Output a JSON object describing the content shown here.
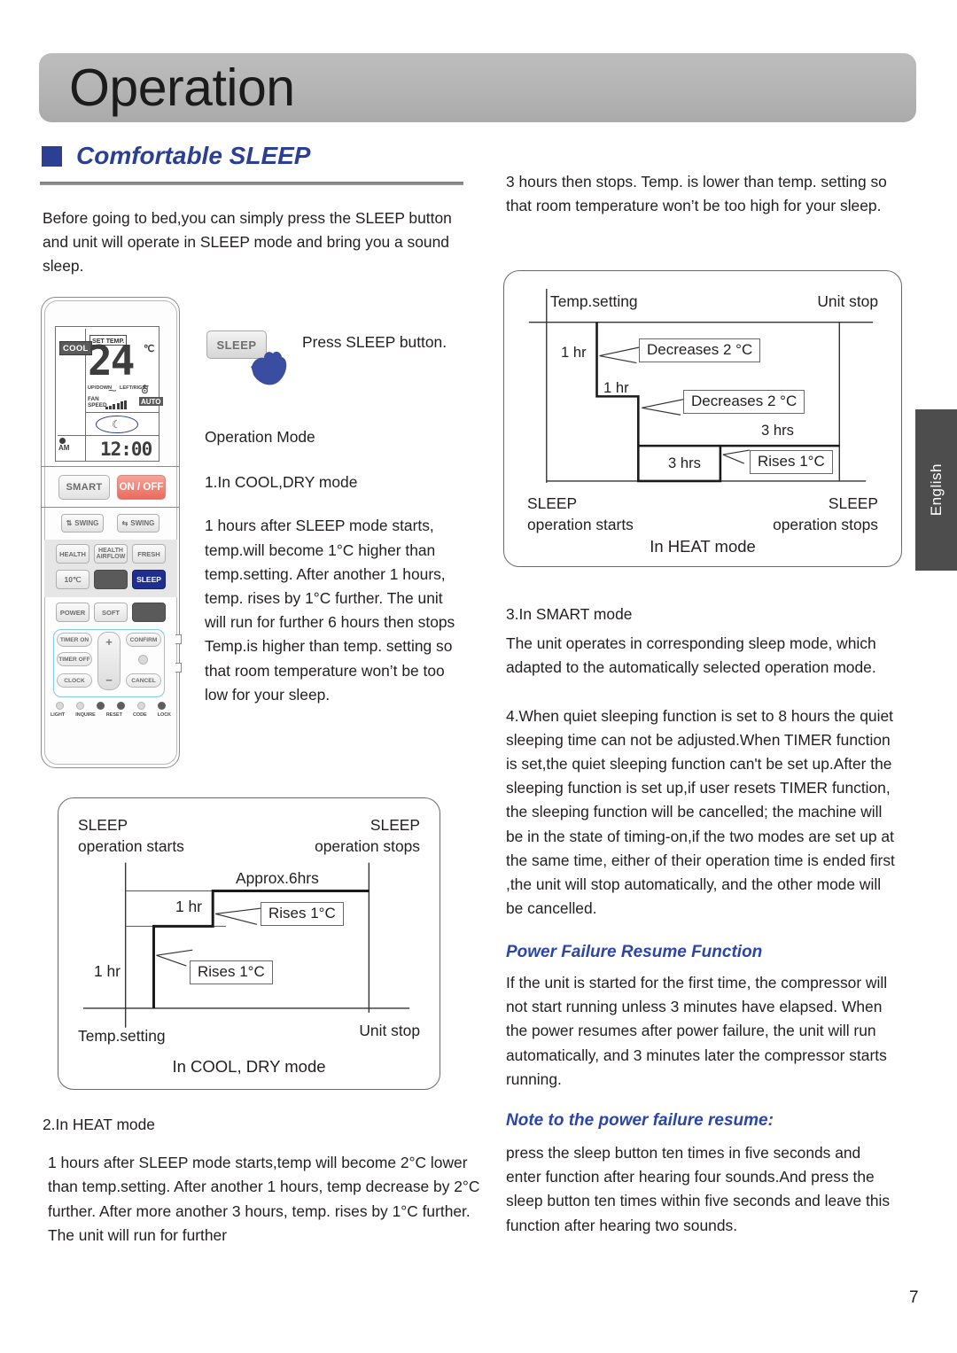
{
  "header": {
    "title": "Operation"
  },
  "section": {
    "title": "Comfortable SLEEP"
  },
  "page_number": "7",
  "language_tab": "English",
  "left_column": {
    "intro": "Before going to bed,you can simply press the SLEEP button and unit will operate in SLEEP mode and bring you a sound sleep.",
    "press_instruction": "Press SLEEP button.",
    "sleep_button_label": "SLEEP",
    "operation_mode_heading": "Operation Mode",
    "mode1_heading": "1.In COOL,DRY mode",
    "mode1_body": "1 hours after SLEEP mode starts, temp.will become 1°C higher than temp.setting. After another 1 hours, temp. rises by 1°C further. The unit will run for further 6 hours then stops Temp.is higher than temp. setting so that room temperature won’t be too low for your sleep.",
    "mode2_heading": "2.In HEAT mode",
    "mode2_body": "1 hours after SLEEP mode starts,temp will become 2°C lower than temp.setting. After another 1 hours, temp decrease by 2°C further. After more another 3 hours, temp. rises by 1°C further. The unit will run for further"
  },
  "right_column": {
    "continuation": "3 hours then stops. Temp. is lower than temp. setting so that room temperature won’t be too high for your sleep.",
    "mode3_heading": "3.In SMART mode",
    "mode3_body": "The unit operates in corresponding sleep mode, which adapted to the automatically selected operation mode.",
    "note4_body": "4.When quiet sleeping function is set to 8 hours the quiet sleeping time can not be adjusted.When TIMER function is set,the quiet sleeping function can't be set up.After the sleeping function is set up,if user resets TIMER function, the sleeping function will be cancelled; the machine will be in the state of timing-on,if the two modes are set up at the same time, either of their operation time is ended first ,the unit will stop automatically, and the other mode will be cancelled.",
    "power_failure_heading": "Power Failure Resume Function",
    "power_failure_body": "If the unit is started for the first time, the compressor will not start running unless 3 minutes have elapsed. When the power resumes after power failure, the unit will run automatically, and 3 minutes later the compressor starts running.",
    "note_heading": "Note to the power failure resume:",
    "note_body": "press the sleep button ten times in five seconds and enter function after hearing four sounds.And press the sleep button ten times within five seconds and leave this function after hearing two sounds."
  },
  "remote": {
    "display": {
      "mode_tag": "COOL",
      "set_temp_label": "SET TEMP.",
      "temperature": "24",
      "unit": "℃",
      "updown_label": "UP/DOWN",
      "leftright_label": "LEFT/RIGHT",
      "fan_label_line1": "FAN",
      "fan_label_line2": "SPEED",
      "auto_tag": "AUTO",
      "am_label": "AM",
      "clock": "12:00"
    },
    "buttons": {
      "smart": "SMART",
      "on_off": "ON / OFF",
      "swing_vertical": "SWING",
      "swing_horizontal": "SWING",
      "health": "HEALTH",
      "health_airflow_line1": "HEALTH",
      "health_airflow_line2": "AIRFLOW",
      "fresh": "FRESH",
      "ten_degree": "10℃",
      "sleep": "SLEEP",
      "power": "POWER",
      "soft": "SOFT",
      "timer_on": "TIMER ON",
      "timer_off": "TIMER OFF",
      "clock": "CLOCK",
      "confirm": "CONFIRM",
      "cancel": "CANCEL",
      "plus": "+",
      "minus": "−"
    },
    "bottom_labels": [
      "LIGHT",
      "INQUIRE",
      "RESET",
      "CODE",
      "LOCK"
    ]
  },
  "chart_data": [
    {
      "type": "line",
      "title": "In COOL, DRY mode",
      "description": "Step chart of temperature over time during SLEEP operation in COOL/DRY mode",
      "xlabel": "",
      "ylabel": "",
      "grid": false,
      "annotations": {
        "top_left": "SLEEP",
        "top_left_sub": "operation starts",
        "top_right": "SLEEP",
        "top_right_sub": "operation stops",
        "duration_top": "Approx.6hrs",
        "step1_duration": "1 hr",
        "step2_duration": "1 hr",
        "step1_callout": "Rises 1°C",
        "step2_callout": "Rises 1°C",
        "baseline_left": "Temp.setting",
        "baseline_right": "Unit stop"
      },
      "steps": [
        {
          "label": "1 hr",
          "level": 0,
          "change": "Rises 1°C"
        },
        {
          "label": "1 hr",
          "level": 1,
          "change": "Rises 1°C"
        },
        {
          "label": "Approx.6hrs",
          "level": 2,
          "change": ""
        }
      ]
    },
    {
      "type": "line",
      "title": "In HEAT mode",
      "description": "Step chart of temperature over time during SLEEP operation in HEAT mode",
      "xlabel": "",
      "ylabel": "",
      "grid": false,
      "annotations": {
        "top_left": "Temp.setting",
        "top_right": "Unit stop",
        "step1_duration": "1 hr",
        "step2_duration": "1 hr",
        "step3_duration": "3 hrs",
        "step4_duration": "3 hrs",
        "step1_callout": "Decreases 2 °C",
        "step2_callout": "Decreases 2 °C",
        "step3_callout": "Rises 1°C",
        "bottom_left": "SLEEP",
        "bottom_left_sub": "operation starts",
        "bottom_right": "SLEEP",
        "bottom_right_sub": "operation stops"
      },
      "steps": [
        {
          "label": "1 hr",
          "level": 0,
          "change": "Decreases 2 °C"
        },
        {
          "label": "1 hr",
          "level": -1,
          "change": "Decreases 2 °C"
        },
        {
          "label": "3 hrs",
          "level": -2,
          "change": ""
        },
        {
          "label": "3 hrs",
          "level": -1,
          "change": "Rises 1°C"
        }
      ]
    }
  ],
  "colors": {
    "accent_blue": "#2b3f93",
    "banner_gray": "#b4b4b4",
    "tab_dark": "#4d4d4d",
    "sleep_highlight": "#1f2f8f",
    "onoff_red": "#ea6a5c"
  }
}
